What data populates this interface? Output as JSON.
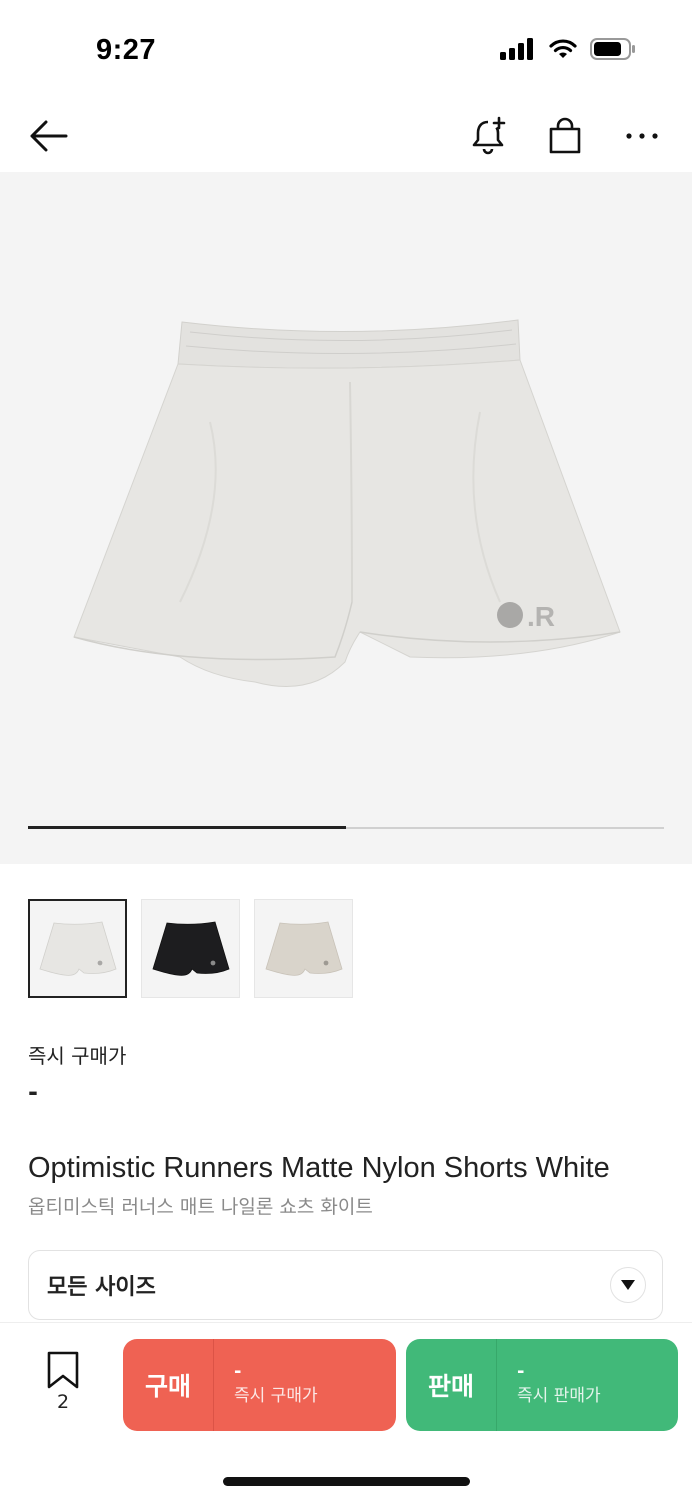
{
  "status_bar": {
    "time": "9:27",
    "icons": [
      "cellular-signal-icon",
      "wifi-icon",
      "battery-icon"
    ]
  },
  "nav": {
    "icons": [
      "back-arrow-icon",
      "bell-plus-icon",
      "shopping-bag-icon",
      "more-dots-icon"
    ]
  },
  "gallery": {
    "progress": 0.5,
    "thumbnails": [
      {
        "color": "white",
        "selected": true
      },
      {
        "color": "black",
        "selected": false
      },
      {
        "color": "beige",
        "selected": false
      }
    ]
  },
  "price": {
    "label": "즉시 구매가",
    "value": "-"
  },
  "product": {
    "name": "Optimistic Runners Matte Nylon Shorts White",
    "name_kr": "옵티미스틱 러너스 매트 나일론 쇼츠 화이트"
  },
  "size_select": {
    "value": "모든 사이즈"
  },
  "bottom": {
    "wish_count": "2",
    "buy": {
      "title": "구매",
      "price": "-",
      "sub": "즉시 구매가"
    },
    "sell": {
      "title": "판매",
      "price": "-",
      "sub": "즉시 판매가"
    }
  },
  "colors": {
    "buy": "#ef6253",
    "sell": "#41b979",
    "gallery_bg": "#f4f4f4"
  }
}
